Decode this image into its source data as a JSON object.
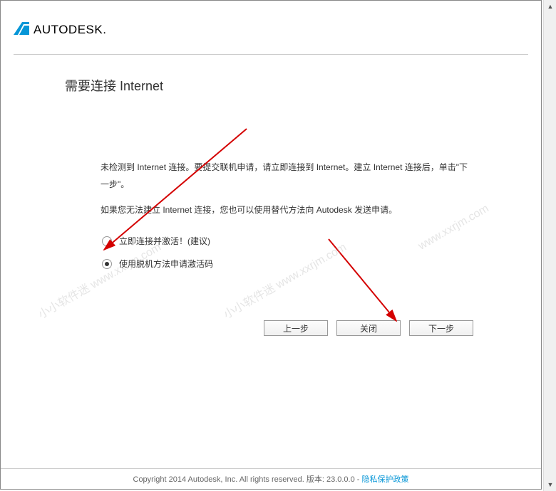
{
  "brand": {
    "name": "AUTODESK",
    "logo_sub": "."
  },
  "page": {
    "title": "需要连接 Internet",
    "paragraph1": "未检测到 Internet 连接。要提交联机申请，请立即连接到 Internet。建立 Internet 连接后，单击\"下一步\"。",
    "paragraph2": "如果您无法建立 Internet 连接，您也可以使用替代方法向 Autodesk 发送申请。"
  },
  "options": [
    {
      "label": "立即连接并激活！(建议)",
      "selected": false
    },
    {
      "label": "使用脱机方法申请激活码",
      "selected": true
    }
  ],
  "buttons": {
    "back": "上一步",
    "close": "关闭",
    "next": "下一步"
  },
  "footer": {
    "copyright": "Copyright 2014 Autodesk, Inc. All rights reserved. 版本: 23.0.0.0 - ",
    "privacy": "隐私保护政策"
  },
  "watermarks": [
    "小小软件迷  www.xxrjm.com",
    "小小软件迷  www.xxrjm.com",
    "www.xxrjm.com"
  ]
}
